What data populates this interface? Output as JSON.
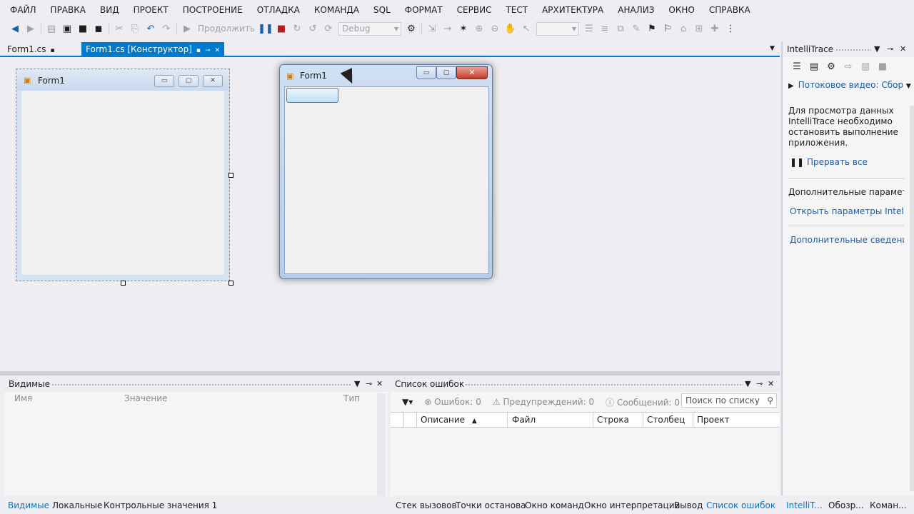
{
  "menu": [
    "ФАЙЛ",
    "ПРАВКА",
    "ВИД",
    "ПРОЕКТ",
    "ПОСТРОЕНИЕ",
    "ОТЛАДКА",
    "КОМАНДА",
    "SQL",
    "ФОРМАТ",
    "СЕРВИС",
    "ТЕСТ",
    "АРХИТЕКТУРА",
    "АНАЛИЗ",
    "ОКНО",
    "СПРАВКА"
  ],
  "toolbar": {
    "continue_label": "Продолжить",
    "config_value": "Debug"
  },
  "tabs": {
    "inactive": "Form1.cs",
    "active": "Form1.cs [Конструктор]"
  },
  "designer_form": {
    "title": "Form1"
  },
  "running_form": {
    "title": "Form1"
  },
  "intellitrace": {
    "title": "IntelliTrace",
    "stream_label": "Потоковое видео: Сбор",
    "message": "Для просмотра данных IntelliTrace необходимо остановить выполнение приложения.",
    "break_all": "Прервать все",
    "additional_params": "Дополнительные параметры",
    "open_params": "Открыть параметры IntelliTra",
    "more_info": "Дополнительные сведения о"
  },
  "watch_panel": {
    "title": "Видимые",
    "columns": [
      "Имя",
      "Значение",
      "Тип"
    ]
  },
  "error_list": {
    "title": "Список ошибок",
    "errors": "Ошибок: 0",
    "warnings": "Предупреждений: 0",
    "messages": "Сообщений: 0",
    "search_placeholder": "Поиск по списку",
    "columns": [
      "Описание",
      "Файл",
      "Строка",
      "Столбец",
      "Проект"
    ]
  },
  "bottom_tabs_left": [
    "Видимые",
    "Локальные",
    "Контрольные значения 1"
  ],
  "bottom_tabs_right": [
    "Стек вызовов",
    "Точки останова",
    "Окно команд",
    "Окно интерпретации",
    "Вывод",
    "Список ошибок"
  ],
  "bottom_tabs_far": [
    "IntelliT...",
    "Обозр...",
    "Коман..."
  ],
  "colors": {
    "accent": "#007acc",
    "link": "#1c5fa8"
  }
}
